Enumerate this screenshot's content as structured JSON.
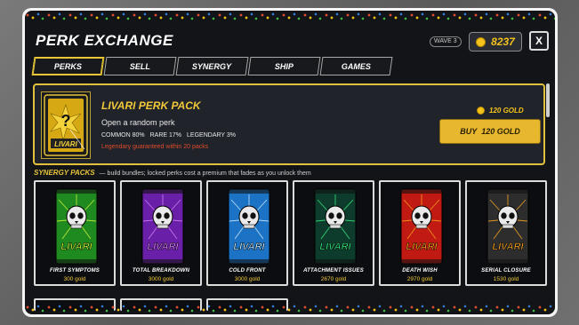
{
  "header": {
    "title": "PERK EXCHANGE",
    "wave": "WAVE 3",
    "gold": "8237",
    "close_label": "X"
  },
  "tabs": [
    {
      "label": "PERKS",
      "active": true
    },
    {
      "label": "SELL",
      "active": false
    },
    {
      "label": "SYNERGY",
      "active": false
    },
    {
      "label": "SHIP",
      "active": false
    },
    {
      "label": "GAMES",
      "active": false
    }
  ],
  "featured": {
    "title": "LIVARI PERK PACK",
    "card_brand": "LIVARI",
    "subtitle": "Open a random perk",
    "odds": [
      "COMMON 80%",
      "RARE 17%",
      "LEGENDARY 3%"
    ],
    "note": "Legendary guaranteed within 20 packs",
    "price": "120 GOLD",
    "buy_label": "BUY",
    "buy_price": "120 GOLD"
  },
  "synergy": {
    "title": "SYNERGY PACKS",
    "description": "— build bundles; locked perks cost a premium that fades as you unlock them",
    "brand": "LIVARI",
    "packs": [
      {
        "name": "FIRST SYMPTOMS",
        "price": "300 gold",
        "color": "#1f8a1f",
        "accent": "#c6f03a"
      },
      {
        "name": "TOTAL BREAKDOWN",
        "price": "3000 gold",
        "color": "#6a1fa8",
        "accent": "#cf7cf2"
      },
      {
        "name": "COLD FRONT",
        "price": "3000 gold",
        "color": "#1c72c4",
        "accent": "#bfe6ff"
      },
      {
        "name": "ATTACHMENT ISSUES",
        "price": "2670 gold",
        "color": "#0d3b2c",
        "accent": "#35e07a"
      },
      {
        "name": "DEATH WISH",
        "price": "2970 gold",
        "color": "#c11a12",
        "accent": "#f39a1a"
      },
      {
        "name": "SERIAL CLOSURE",
        "price": "1530 gold",
        "color": "#2d2d2d",
        "accent": "#f0a020"
      }
    ]
  },
  "colors": {
    "accent_gold": "#f3c21c",
    "panel_bg": "#121418",
    "legendary_note": "#e04a2a"
  }
}
